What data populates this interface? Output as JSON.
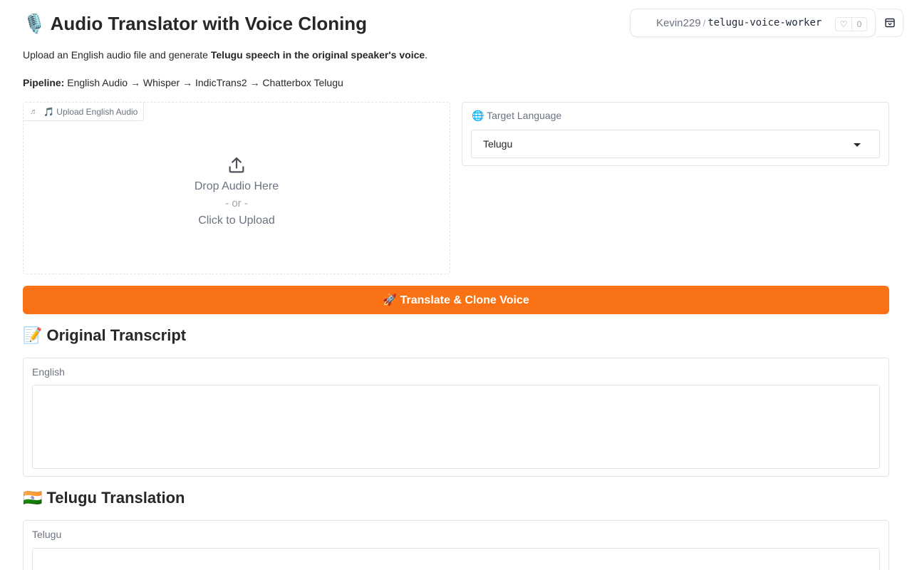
{
  "space_badge": {
    "owner": "Kevin229",
    "separator": "/",
    "repo": "telugu-voice-worker",
    "like_icon": "heart-icon",
    "like_count": "0",
    "menu_icon": "collapse-icon"
  },
  "header": {
    "title_emoji": "🎙️",
    "title": "Audio Translator with Voice Cloning"
  },
  "intro": {
    "prefix": "Upload an English audio file and generate ",
    "bold": "Telugu speech in the original speaker's voice",
    "suffix": "."
  },
  "pipeline": {
    "label": "Pipeline:",
    "text": " English Audio → Whisper → IndicTrans2 → Chatterbox Telugu"
  },
  "upload": {
    "label": "🎵 Upload English Audio",
    "label_icon": "music-note-icon",
    "icon": "upload-icon",
    "drop_text": "Drop Audio Here",
    "or_text": "- or -",
    "click_text": "Click to Upload"
  },
  "language": {
    "label": "🌐 Target Language",
    "selected": "Telugu"
  },
  "translate_button": {
    "label": "🚀 Translate & Clone Voice"
  },
  "transcript_section": {
    "heading": "📝 Original Transcript",
    "field_label": "English",
    "value": ""
  },
  "translation_section": {
    "heading": "🇮🇳 Telugu Translation",
    "field_label": "Telugu",
    "value": ""
  },
  "colors": {
    "accent": "#f97316",
    "border": "#e4e4e7"
  }
}
